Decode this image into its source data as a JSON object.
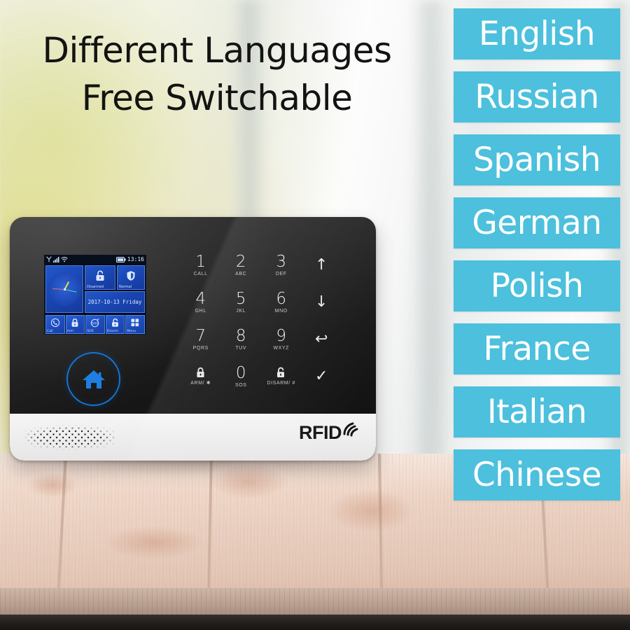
{
  "headline": {
    "text": "Different Languages\nFree Switchable"
  },
  "languages": {
    "items": [
      {
        "label": "English"
      },
      {
        "label": "Russian"
      },
      {
        "label": "Spanish"
      },
      {
        "label": "German"
      },
      {
        "label": "Polish"
      },
      {
        "label": "France"
      },
      {
        "label": "Italian"
      },
      {
        "label": "Chinese"
      }
    ],
    "chip_color": "#4cc0dd",
    "text_color": "#ffffff"
  },
  "device": {
    "brand_mark": "RFID",
    "accent_color": "#1673d6",
    "body_color": "#141414",
    "base_color": "#efefef",
    "screen": {
      "status_bar": {
        "time": "13:16",
        "icons": [
          "antenna-icon",
          "signal-bars-icon",
          "wifi-icon",
          "battery-icon"
        ]
      },
      "tiles": {
        "arm_state": {
          "label": "Disarmed",
          "icon": "unlock-icon"
        },
        "system_state": {
          "label": "Normal",
          "icon": "shield-icon"
        },
        "date": "2017-10-13 Friday"
      },
      "nav": [
        {
          "label": "Call",
          "icon": "phone-icon"
        },
        {
          "label": "Arm",
          "icon": "lock-icon"
        },
        {
          "label": "SOS",
          "icon": "sos-icon"
        },
        {
          "label": "Disarm",
          "icon": "unlock-icon"
        },
        {
          "label": "Menu",
          "icon": "grid-icon"
        }
      ]
    },
    "keypad": [
      {
        "digit": "1",
        "sub": "CALL",
        "glyph": ""
      },
      {
        "digit": "2",
        "sub": "ABC",
        "glyph": ""
      },
      {
        "digit": "3",
        "sub": "DEF",
        "glyph": ""
      },
      {
        "digit": "",
        "sub": "",
        "glyph": "↑"
      },
      {
        "digit": "4",
        "sub": "GHL",
        "glyph": ""
      },
      {
        "digit": "5",
        "sub": "JKL",
        "glyph": ""
      },
      {
        "digit": "6",
        "sub": "MNO",
        "glyph": ""
      },
      {
        "digit": "",
        "sub": "",
        "glyph": "↓"
      },
      {
        "digit": "7",
        "sub": "PQRS",
        "glyph": ""
      },
      {
        "digit": "8",
        "sub": "TUV",
        "glyph": ""
      },
      {
        "digit": "9",
        "sub": "WXYZ",
        "glyph": ""
      },
      {
        "digit": "",
        "sub": "",
        "glyph": "↩"
      },
      {
        "digit": "",
        "sub": "ARM/ ✱",
        "glyph": ""
      },
      {
        "digit": "0",
        "sub": "SOS",
        "glyph": ""
      },
      {
        "digit": "",
        "sub": "DISARM/ #",
        "glyph": ""
      },
      {
        "digit": "",
        "sub": "",
        "glyph": "✓"
      }
    ],
    "home_button": {
      "icon": "home-icon"
    }
  }
}
